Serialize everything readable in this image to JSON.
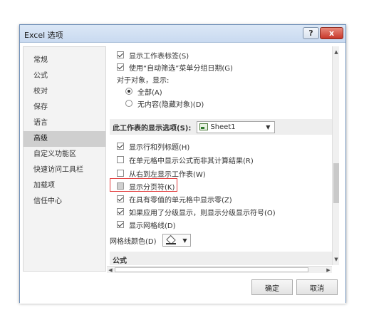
{
  "dialog": {
    "title": "Excel 选项",
    "help_label": "?",
    "close_label": "x",
    "ok_label": "确定",
    "cancel_label": "取消"
  },
  "sidebar": {
    "items": [
      {
        "label": "常规"
      },
      {
        "label": "公式"
      },
      {
        "label": "校对"
      },
      {
        "label": "保存"
      },
      {
        "label": "语言"
      },
      {
        "label": "高级",
        "selected": true
      },
      {
        "label": "自定义功能区"
      },
      {
        "label": "快速访问工具栏"
      },
      {
        "label": "加载项"
      },
      {
        "label": "信任中心"
      }
    ]
  },
  "content": {
    "show_sheet_tabs": {
      "label": "显示工作表标签(S)",
      "checked": true
    },
    "group_dates": {
      "label": "使用“自动筛选”菜单分组日期(G)",
      "checked": true
    },
    "objects_label": "对于对象，显示:",
    "radio_all": {
      "label": "全部(A)",
      "checked": true
    },
    "radio_none": {
      "label": "无内容(隐藏对象)(D)",
      "checked": false
    },
    "worksheet_section": {
      "label": "此工作表的显示选项(S):",
      "sheet_value": "Sheet1"
    },
    "show_headers": {
      "label": "显示行和列标题(H)",
      "checked": true
    },
    "show_formulas": {
      "label": "在单元格中显示公式而非其计算结果(R)",
      "checked": false
    },
    "right_to_left": {
      "label": "从右到左显示工作表(W)",
      "checked": false
    },
    "show_page_breaks": {
      "label": "显示分页符(K)",
      "checked": false
    },
    "show_zero": {
      "label": "在具有零值的单元格中显示零(Z)",
      "checked": true
    },
    "show_outline": {
      "label": "如果应用了分级显示，则显示分级显示符号(O)",
      "checked": true
    },
    "show_gridlines": {
      "label": "显示网格线(D)",
      "checked": true
    },
    "gridline_color_label": "网格线颜色(D)",
    "formulas_section_label": "公式"
  },
  "icons": {
    "dropdown": "chevron-down-icon",
    "fill_color": "paint-bucket-icon",
    "sheet": "sheet-icon"
  },
  "colors": {
    "highlight_border": "#e23b3b",
    "selected_sidebar": "#cfcfcf",
    "close_button": "#c8382b"
  }
}
